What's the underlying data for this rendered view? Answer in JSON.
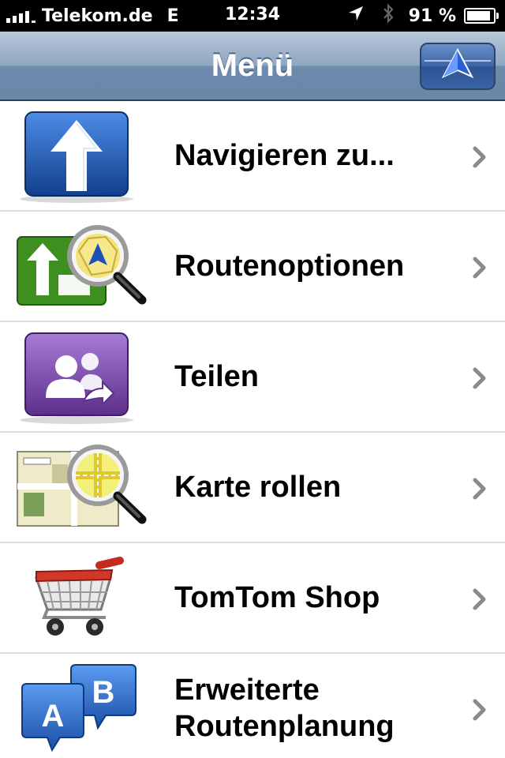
{
  "status_bar": {
    "carrier": "Telekom.de",
    "network": "E",
    "time": "12:34",
    "battery_percent": "91 %",
    "battery_level": 0.91,
    "icons": [
      "signal-icon",
      "location-arrow-icon",
      "bluetooth-icon",
      "battery-icon"
    ]
  },
  "nav": {
    "title": "Menü",
    "right_button_icon": "navigation-view-icon"
  },
  "menu": {
    "items": [
      {
        "label": "Navigieren zu...",
        "icon": "navigate-arrow-icon"
      },
      {
        "label": "Routenoptionen",
        "icon": "route-options-icon"
      },
      {
        "label": "Teilen",
        "icon": "share-people-icon"
      },
      {
        "label": "Karte rollen",
        "icon": "browse-map-icon"
      },
      {
        "label": "TomTom Shop",
        "icon": "shopping-cart-icon"
      },
      {
        "label_line1": "Erweiterte",
        "label_line2": "Routenplanung",
        "icon": "ab-route-planning-icon"
      }
    ]
  },
  "colors": {
    "nav_gradient_top": "#b9c8da",
    "nav_gradient_bottom": "#6a87a8",
    "navigate_icon_blue": "#1f4f9e",
    "route_icon_green": "#3d8f1f",
    "share_icon_purple": "#7a4aa6",
    "chevron_gray": "#8a8a8a"
  }
}
